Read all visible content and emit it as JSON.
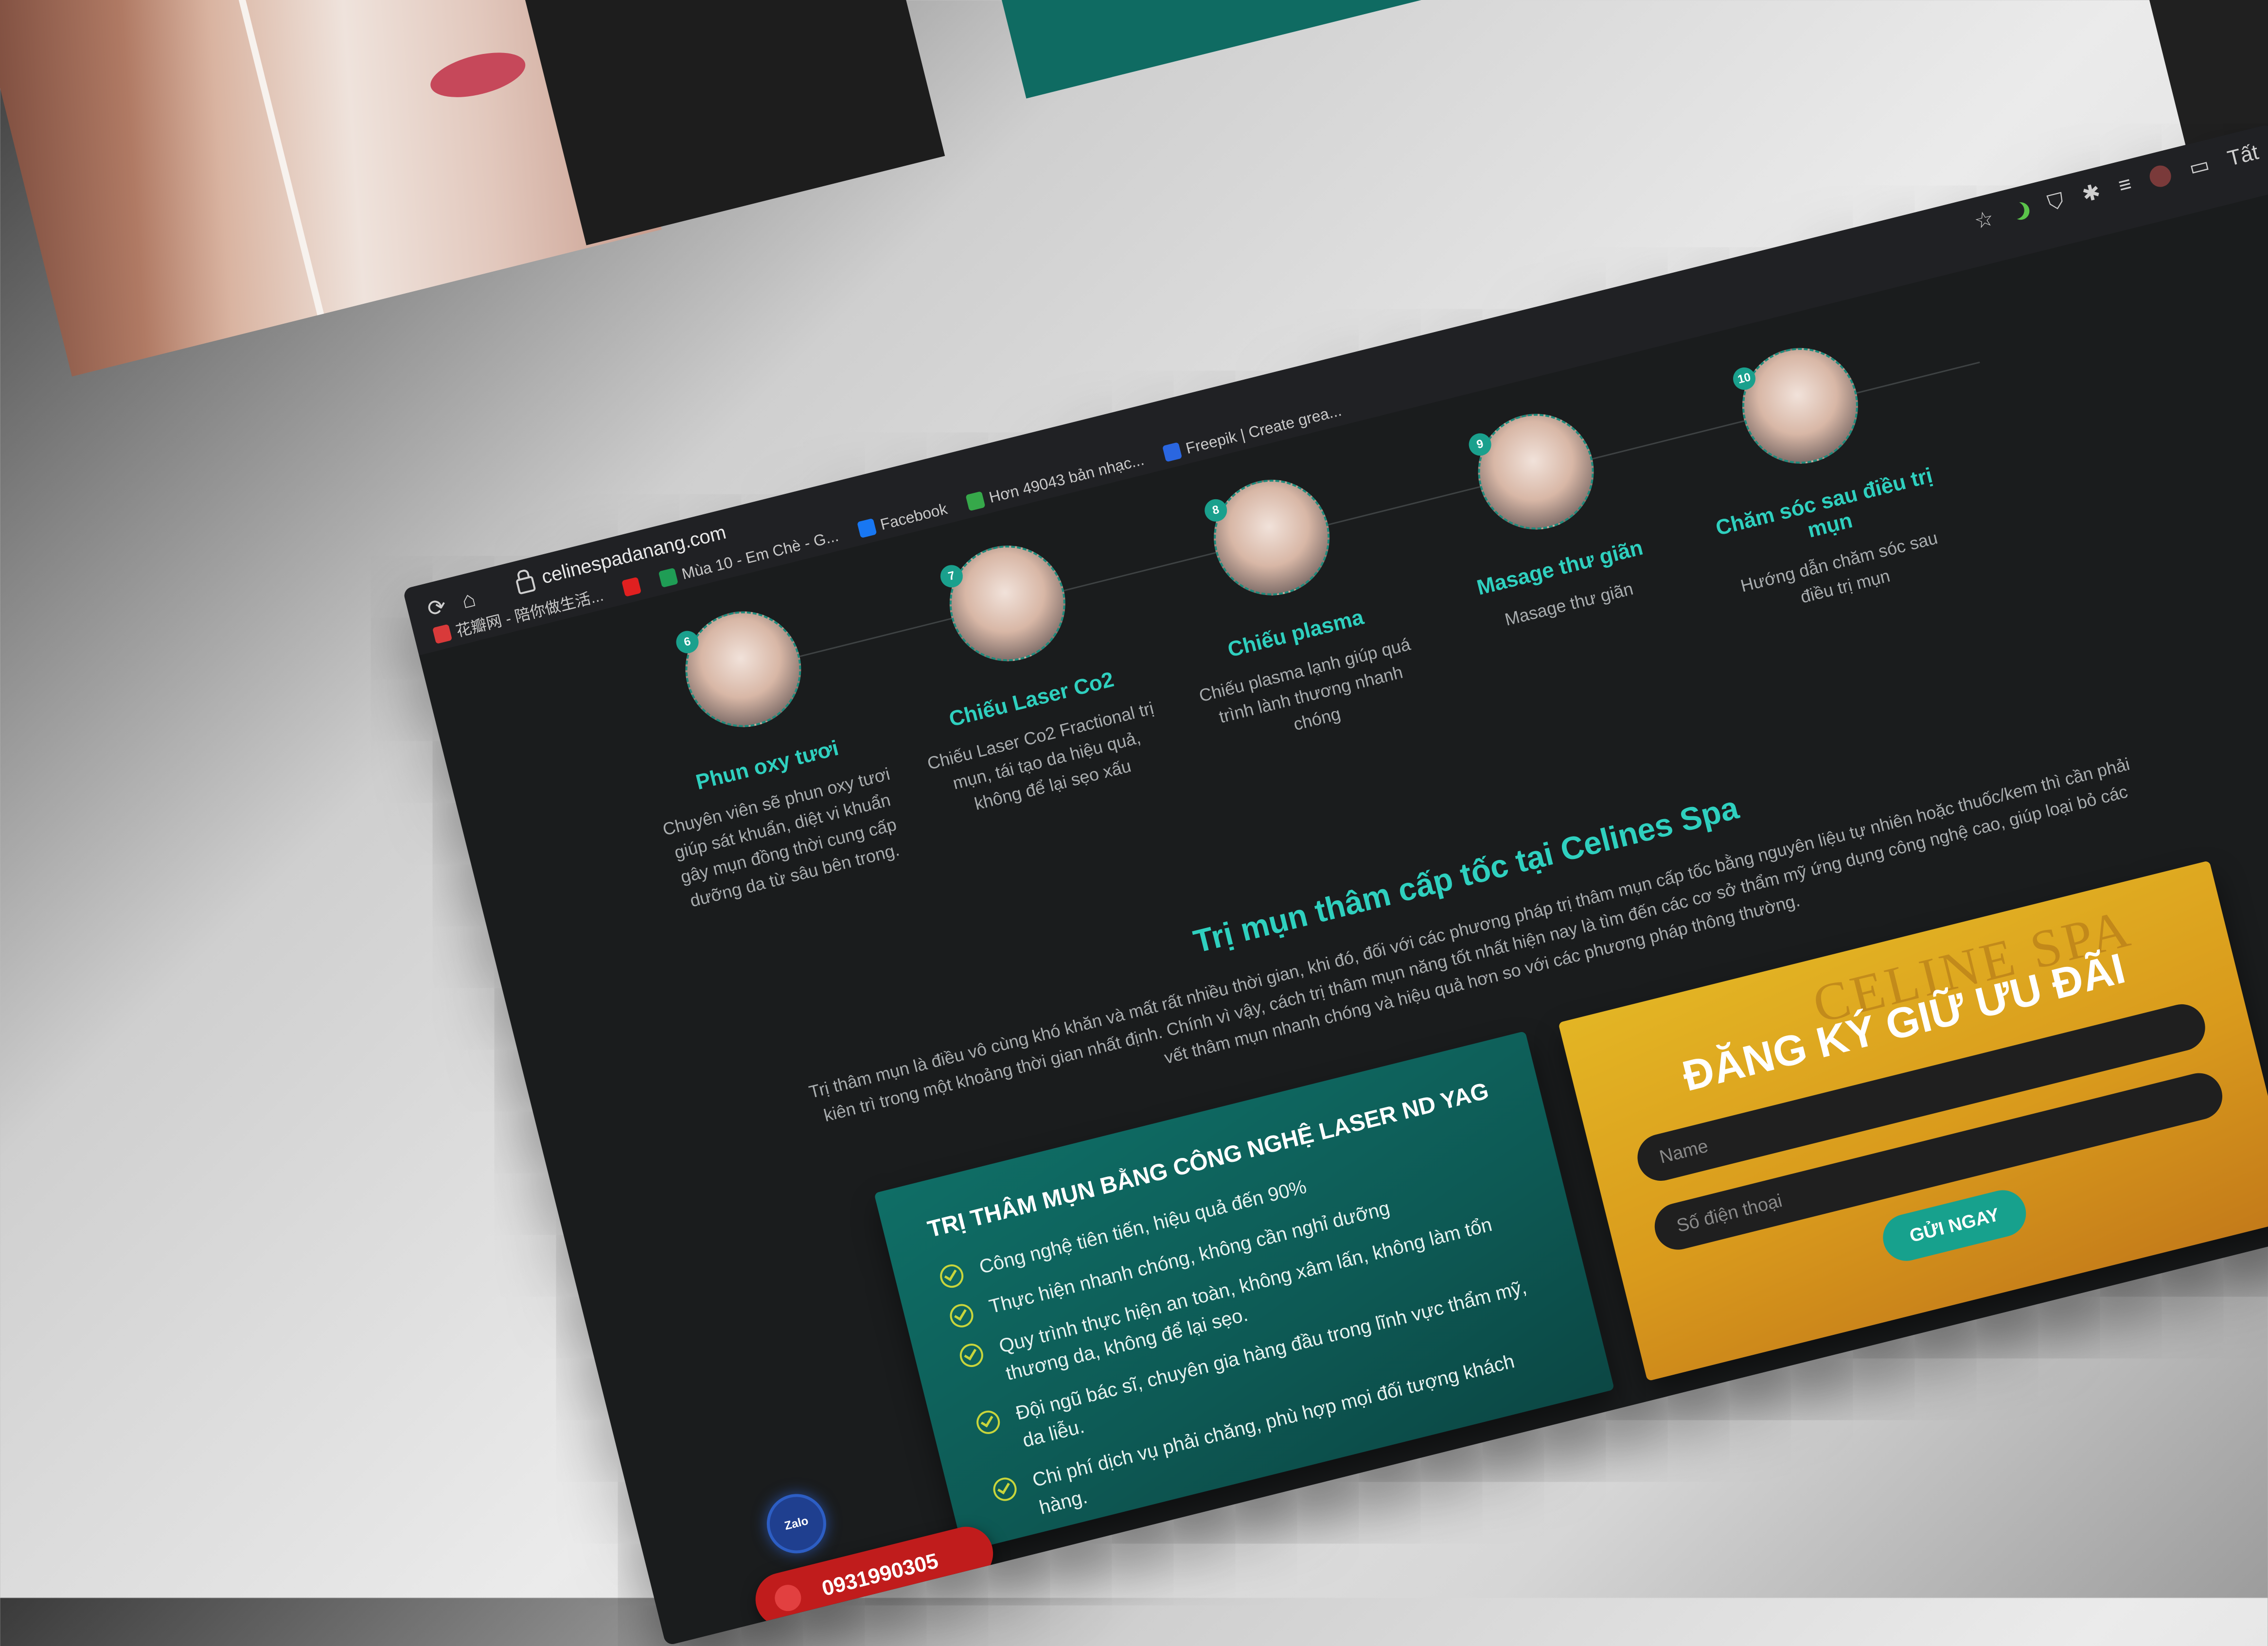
{
  "browser": {
    "url": "celinespadanang.com",
    "bookmarks": [
      {
        "label": "花瓣网 - 陪你做生活...",
        "icon": "huaban-icon",
        "color": "#d93a3a"
      },
      {
        "label": "",
        "icon": "youtube-icon",
        "color": "#e02020"
      },
      {
        "label": "Mùa 10 - Em Chè - G...",
        "icon": "sheets-icon",
        "color": "#1f9d55"
      },
      {
        "label": "Facebook",
        "icon": "facebook-icon",
        "color": "#1877f2"
      },
      {
        "label": "Hơn 49043 bản nhạc...",
        "icon": "px-icon",
        "color": "#36a84a"
      },
      {
        "label": "Freepik | Create grea...",
        "icon": "freepik-icon",
        "color": "#2a66e0"
      }
    ],
    "toolbar_right_folder": "Tất"
  },
  "steps": [
    {
      "number": "6",
      "title": "Phun oxy tươi",
      "desc": "Chuyên viên sẽ phun oxy tươi giúp sát khuẩn, diệt vi khuẩn gây mụn đồng thời cung cấp dưỡng da từ sâu bên trong."
    },
    {
      "number": "7",
      "title": "Chiếu Laser Co2",
      "desc": "Chiếu Laser Co2 Fractional trị mụn, tái tạo da hiệu quả, không để lại sẹo xấu"
    },
    {
      "number": "8",
      "title": "Chiếu plasma",
      "desc": "Chiếu plasma lạnh giúp quá trình lành thương nhanh chóng"
    },
    {
      "number": "9",
      "title": "Masage thư giãn",
      "desc": "Masage thư giãn"
    },
    {
      "number": "10",
      "title": "Chăm sóc sau điều trị mụn",
      "desc": "Hướng dẫn chăm sóc sau điều trị mụn"
    }
  ],
  "headline": "Trị mụn thâm cấp tốc tại Celines Spa",
  "intro": "Trị thâm mụn là điều vô cùng khó khăn và mất rất nhiều thời gian, khi đó, đối với các phương pháp trị thâm mụn cấp tốc bằng nguyên liệu tự nhiên hoặc thuốc/kem thì cần phải kiên trì trong một khoảng thời gian nhất định. Chính vì vậy, cách trị thâm mụn năng tốt nhất hiện nay là tìm đến các cơ sở thẩm mỹ ứng dụng công nghệ cao, giúp loại bỏ các vết thâm mụn nhanh chóng và hiệu quả hơn so với các phương pháp thông thường.",
  "laser": {
    "title": "TRỊ THÂM MỤN BẰNG CÔNG NGHỆ LASER ND YAG",
    "items": [
      "Công nghệ tiên tiến, hiệu quả đến 90%",
      "Thực hiện nhanh chóng, không cần nghỉ dưỡng",
      "Quy trình thực hiện an toàn, không xâm lấn, không làm tổn thương da, không để lại sẹo.",
      "Đội ngũ bác sĩ, chuyên gia hàng đầu trong lĩnh vực thẩm mỹ, da liễu.",
      "Chi phí dịch vụ phải chăng, phù hợp mọi đối tượng khách hàng."
    ]
  },
  "form": {
    "watermark": "CELINE SPA",
    "title": "ĐĂNG KÝ GIỮ ƯU ĐÃI",
    "name_placeholder": "Name",
    "phone_placeholder": "Số điện thoại",
    "submit_label": "GỬI NGAY"
  },
  "widgets": {
    "zalo_label": "Zalo",
    "phone_number": "0931990305"
  },
  "colors": {
    "accent_teal": "#2fd0bf",
    "card_teal": "#0f6e66",
    "card_gold": "#e3b524",
    "call_red": "#c01c1c"
  }
}
